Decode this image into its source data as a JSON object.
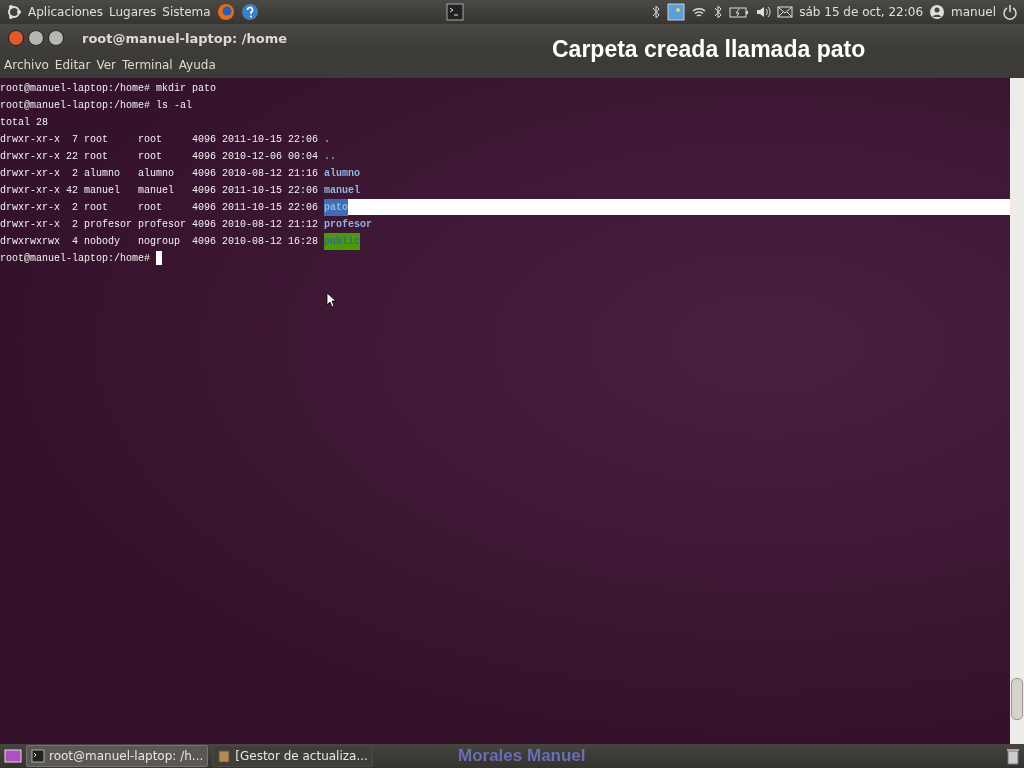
{
  "top_panel": {
    "menus": [
      "Aplicaciones",
      "Lugares",
      "Sistema"
    ],
    "clock": "sáb 15 de oct, 22:06",
    "user": "manuel"
  },
  "window": {
    "title": "root@manuel-laptop: /home",
    "menus": [
      "Archivo",
      "Editar",
      "Ver",
      "Terminal",
      "Ayuda"
    ]
  },
  "caption": "Carpeta creada llamada pato",
  "terminal": {
    "lines": [
      {
        "kind": "text",
        "text": "root@manuel-laptop:/home# mkdir pato"
      },
      {
        "kind": "text",
        "text": "root@manuel-laptop:/home# ls -al"
      },
      {
        "kind": "text",
        "text": "total 28"
      },
      {
        "kind": "entry",
        "listing": "drwxr-xr-x  7 root     root     4096 2011-10-15 22:06 ",
        "name": ".",
        "selected": false
      },
      {
        "kind": "entry",
        "listing": "drwxr-xr-x 22 root     root     4096 2010-12-06 00:04 ",
        "name": "..",
        "selected": false
      },
      {
        "kind": "entry",
        "listing": "drwxr-xr-x  2 alumno   alumno   4096 2010-08-12 21:16 ",
        "name": "alumno",
        "selected": false
      },
      {
        "kind": "entry",
        "listing": "drwxr-xr-x 42 manuel   manuel   4096 2011-10-15 22:06 ",
        "name": "manuel",
        "selected": false
      },
      {
        "kind": "entry",
        "listing": "drwxr-xr-x  2 root     root     4096 2011-10-15 22:06 ",
        "name": "pato",
        "selected": true
      },
      {
        "kind": "entry",
        "listing": "drwxr-xr-x  2 profesor profesor 4096 2010-08-12 21:12 ",
        "name": "profesor",
        "selected": false
      },
      {
        "kind": "shared-entry",
        "listing": "drwxrwxrwx  4 nobody   nogroup  4096 2010-08-12 16:28 ",
        "name": "public",
        "selected": false
      },
      {
        "kind": "prompt",
        "text": "root@manuel-laptop:/home# "
      }
    ]
  },
  "taskbar": {
    "tasks": [
      {
        "label": "root@manuel-laptop: /h...",
        "selected": true
      },
      {
        "label": "[Gestor de actualiza...",
        "selected": false
      }
    ],
    "caption": "Morales Manuel"
  }
}
